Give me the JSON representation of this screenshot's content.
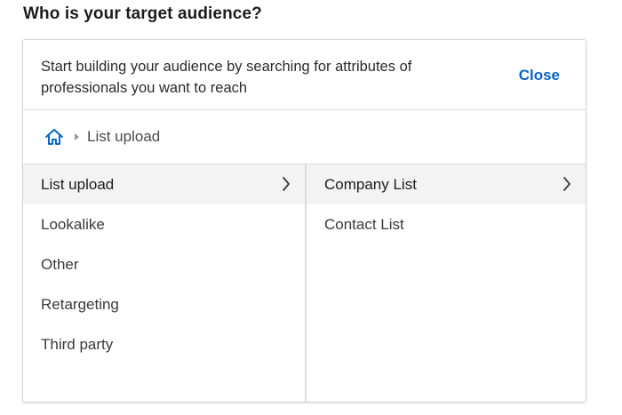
{
  "page": {
    "title": "Who is your target audience?"
  },
  "panel": {
    "description": "Start building your audience by searching for attributes of professionals you want to reach",
    "close_label": "Close"
  },
  "breadcrumb": {
    "home_icon": "home-icon",
    "current": "List upload"
  },
  "categories": [
    {
      "label": "List upload",
      "selected": true,
      "has_children": true
    },
    {
      "label": "Lookalike"
    },
    {
      "label": "Other"
    },
    {
      "label": "Retargeting"
    },
    {
      "label": "Third party"
    }
  ],
  "subcategories": [
    {
      "label": "Company List",
      "selected": true,
      "has_children": true
    },
    {
      "label": "Contact List"
    }
  ],
  "colors": {
    "accent": "#0a66c2",
    "selected_bg": "#f3f3f3"
  }
}
